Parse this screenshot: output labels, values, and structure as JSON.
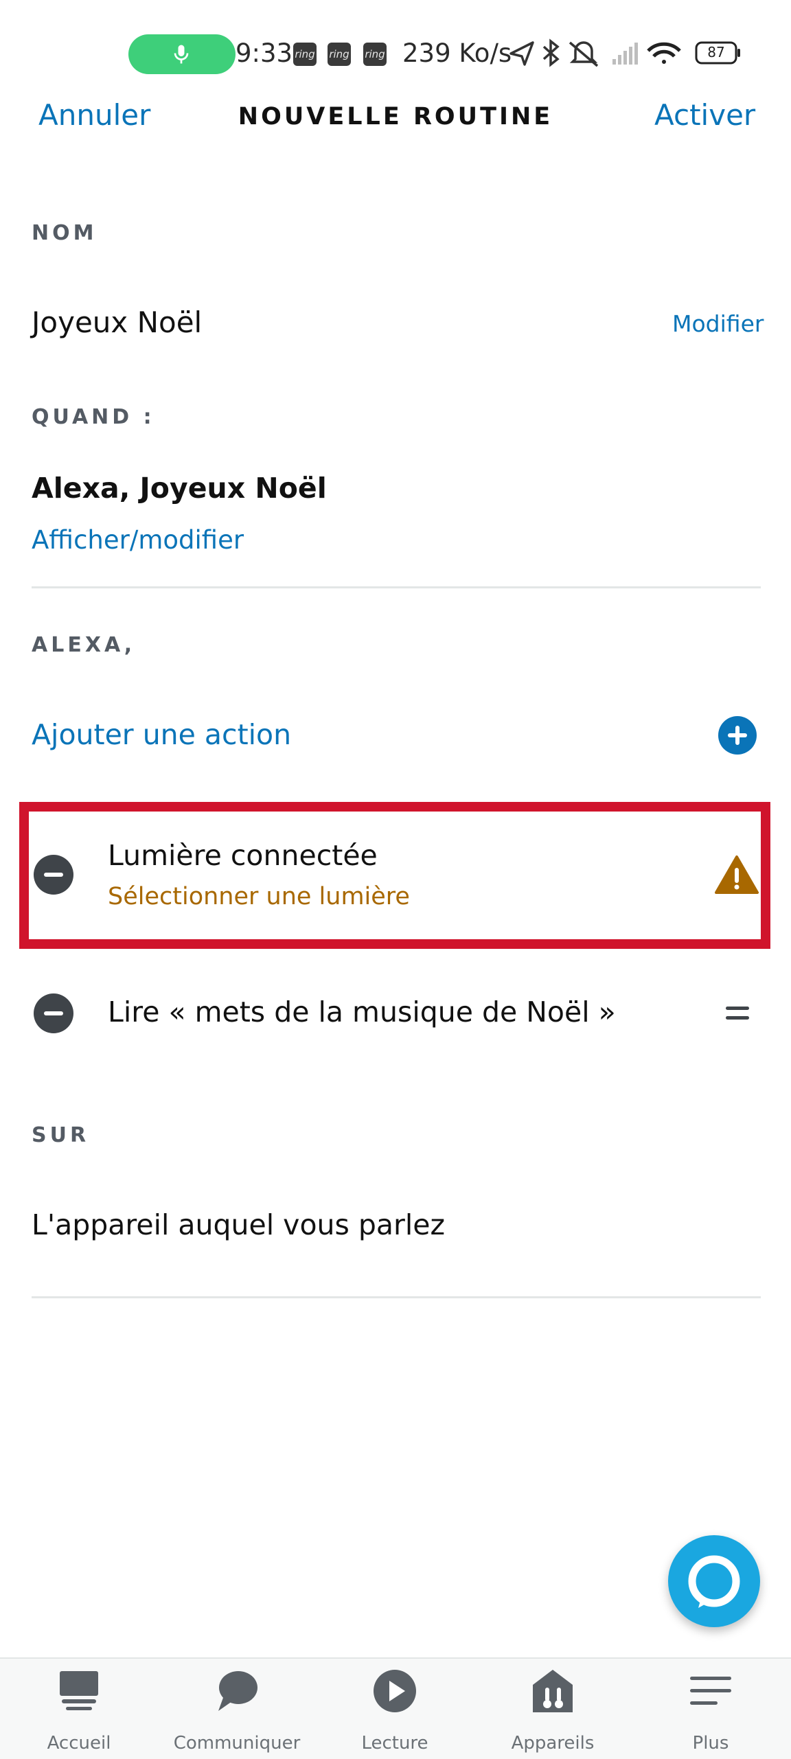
{
  "status_bar": {
    "time": "9:33",
    "ring_badges": [
      "ring",
      "ring",
      "ring"
    ],
    "speed": "239 Ko/s",
    "battery": "87",
    "icons": [
      "mic-icon",
      "location-icon",
      "bluetooth-icon",
      "bell-muted-icon",
      "signal-icon",
      "wifi-icon",
      "battery-icon"
    ]
  },
  "header": {
    "cancel_label": "Annuler",
    "title": "NOUVELLE ROUTINE",
    "activate_label": "Activer"
  },
  "name_section": {
    "label": "NOM",
    "value": "Joyeux Noël",
    "edit_label": "Modifier"
  },
  "when_section": {
    "label": "QUAND :",
    "trigger": "Alexa, Joyeux Noël",
    "view_edit_label": "Afficher/modifier"
  },
  "alexa_section": {
    "label": "ALEXA,",
    "add_action_label": "Ajouter une action",
    "actions": [
      {
        "title": "Lumière connectée",
        "subtitle": "Sélectionner une lumière",
        "status": "warning"
      },
      {
        "title": "Lire « mets de la musique de Noël »"
      }
    ]
  },
  "on_section": {
    "label": "SUR",
    "device": "L'appareil auquel vous parlez"
  },
  "bottom_nav": {
    "items": [
      {
        "label": "Accueil",
        "icon": "home-icon"
      },
      {
        "label": "Communiquer",
        "icon": "chat-bubble-icon"
      },
      {
        "label": "Lecture",
        "icon": "play-icon"
      },
      {
        "label": "Appareils",
        "icon": "devices-icon"
      },
      {
        "label": "Plus",
        "icon": "menu-icon"
      }
    ]
  },
  "colors": {
    "accent_blue": "#0a74b8",
    "warning": "#a86800",
    "highlight_red": "#d0142c",
    "fab": "#1aa7e0"
  }
}
